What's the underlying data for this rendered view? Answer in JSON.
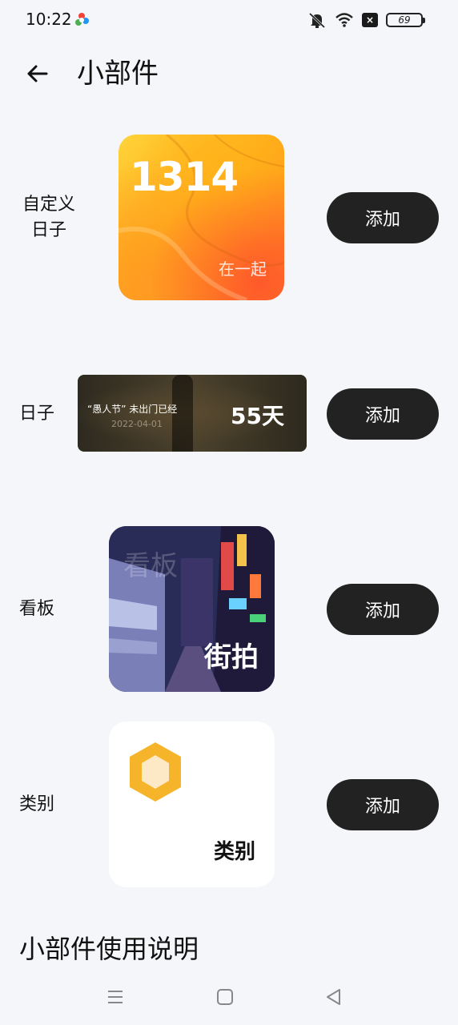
{
  "status_bar": {
    "time": "10:22",
    "app_icon": "colorful-pinwheel-icon",
    "icons": [
      "mute-icon",
      "wifi-icon",
      "notification-x-icon"
    ],
    "notification_glyph": "×",
    "battery_level": "69"
  },
  "header": {
    "back_icon": "arrow-left-icon",
    "title": "小部件"
  },
  "widgets": [
    {
      "label": "自定义\n日子",
      "preview": {
        "number": "1314",
        "caption": "在一起"
      },
      "add_label": "添加"
    },
    {
      "label": "日子",
      "preview": {
        "line1": "“愚人节” 未出门已经",
        "date": "2022-04-01",
        "days": "55天"
      },
      "add_label": "添加"
    },
    {
      "label": "看板",
      "preview": {
        "ghost_text": "看板",
        "caption": "街拍"
      },
      "add_label": "添加"
    },
    {
      "label": "类别",
      "preview": {
        "icon": "hexagon-icon",
        "caption": "类别"
      },
      "add_label": "添加"
    }
  ],
  "usage_title": "小部件使用说明",
  "nav_bar": {
    "icons": [
      "menu-icon",
      "home-square-icon",
      "back-triangle-icon"
    ]
  },
  "colors": {
    "background": "#f5f6f9",
    "button_bg": "#222222",
    "button_text": "#ffffff",
    "accent_orange": "#ffb019",
    "hexagon": "#f6b42b"
  }
}
